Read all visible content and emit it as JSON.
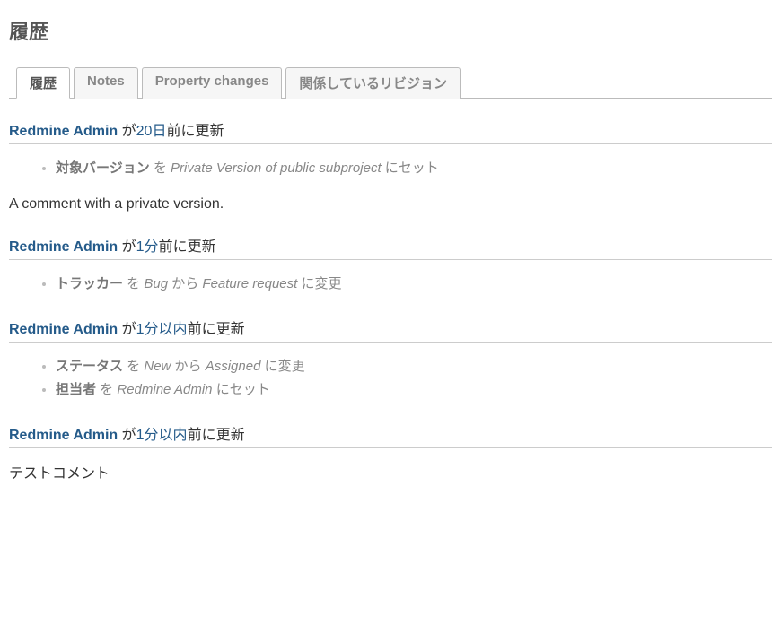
{
  "title": "履歴",
  "tabs": [
    {
      "label": "履歴",
      "active": true
    },
    {
      "label": "Notes",
      "active": false
    },
    {
      "label": "Property changes",
      "active": false
    },
    {
      "label": "関係しているリビジョン",
      "active": false
    }
  ],
  "journals": [
    {
      "user": "Redmine Admin",
      "ga": " が",
      "time": "20日",
      "suffix": "前に更新",
      "details": [
        {
          "prop": "対象バージョン",
          "t1": " を ",
          "v1": "Private Version of public subproject",
          "t2": " にセット",
          "v2": null
        }
      ],
      "note": "A comment with a private version."
    },
    {
      "user": "Redmine Admin",
      "ga": " が",
      "time": "1分",
      "suffix": "前に更新",
      "details": [
        {
          "prop": "トラッカー",
          "t1": " を ",
          "v1": "Bug",
          "t2": " から ",
          "v2": "Feature request",
          "t3": " に変更"
        }
      ],
      "note": null
    },
    {
      "user": "Redmine Admin",
      "ga": " が",
      "time": "1分以内",
      "suffix": "前に更新",
      "details": [
        {
          "prop": "ステータス",
          "t1": " を ",
          "v1": "New",
          "t2": " から ",
          "v2": "Assigned",
          "t3": " に変更"
        },
        {
          "prop": "担当者",
          "t1": " を ",
          "v1": "Redmine Admin",
          "t2": " にセット",
          "v2": null
        }
      ],
      "note": null
    },
    {
      "user": "Redmine Admin",
      "ga": " が",
      "time": "1分以内",
      "suffix": "前に更新",
      "details": [],
      "note": "テストコメント"
    }
  ]
}
